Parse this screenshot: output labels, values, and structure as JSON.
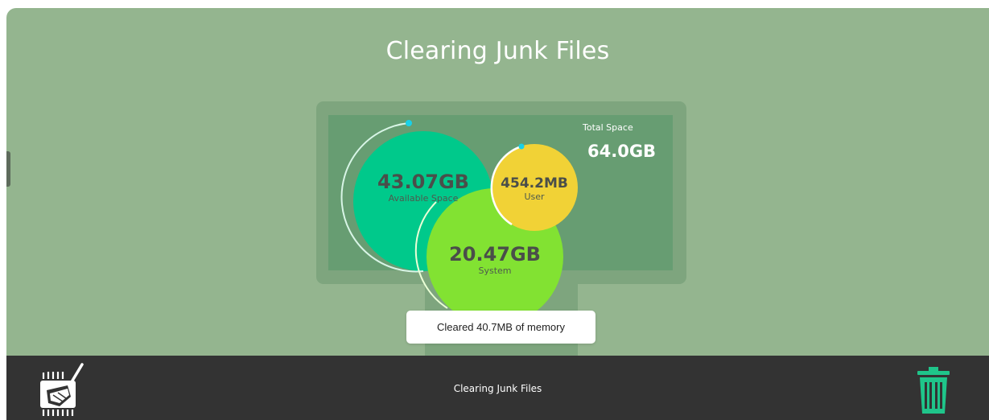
{
  "window": {
    "title": "Clearing Junk Files"
  },
  "storage": {
    "total_label": "Total Space",
    "total_value": "64.0GB",
    "available": {
      "value": "43.07GB",
      "label": "Available Space"
    },
    "user": {
      "value": "454.2MB",
      "label": "User"
    },
    "system": {
      "value": "20.47GB",
      "label": "System"
    }
  },
  "toast": {
    "message": "Cleared  40.7MB  of memory"
  },
  "bottom_bar": {
    "label": "Clearing Junk Files",
    "clean_icon": "broom-chip-icon",
    "trash_icon": "trash-icon"
  },
  "colors": {
    "background": "#94b58f",
    "available": "#00c98b",
    "user": "#f1d236",
    "system": "#82e232",
    "progress_dot": "#19d0e8",
    "bottom_bar": "#333333",
    "trash": "#1fc58a"
  }
}
